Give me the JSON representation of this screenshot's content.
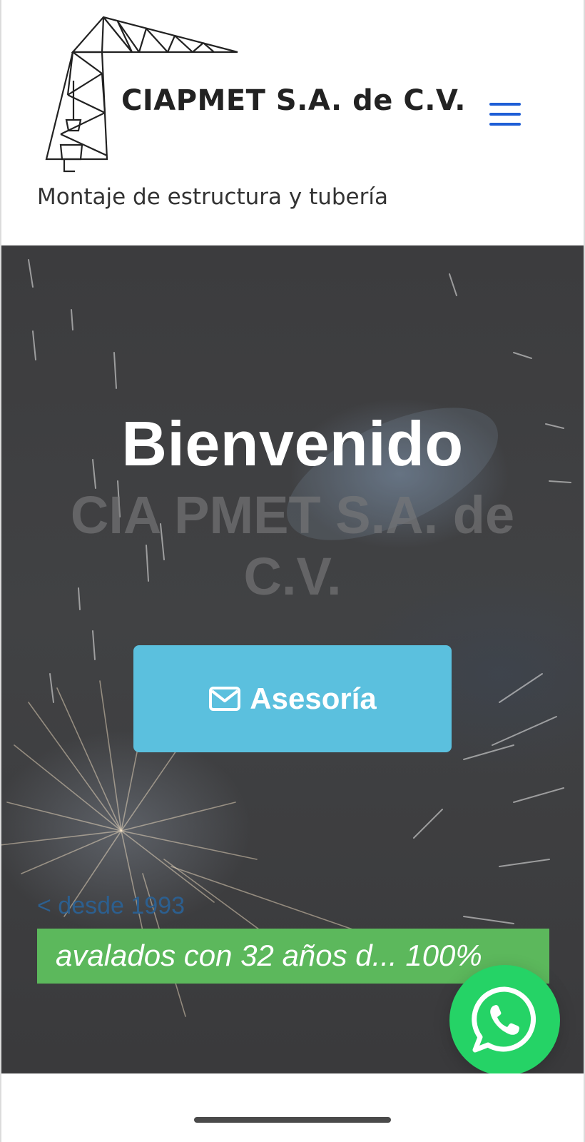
{
  "header": {
    "logo_text": "CIAPMET S.A. de C.V.",
    "tagline": "Montaje de estructura y tubería",
    "menu_icon": "hamburger-menu-icon",
    "menu_color": "#1e5ed6"
  },
  "hero": {
    "title": "Bienvenido",
    "subtitle": "CIA PMET S.A. de C.V.",
    "cta": {
      "label": "Asesoría",
      "icon": "envelope-icon",
      "color": "#5bc0de"
    },
    "since_link": "< desde 1993",
    "progress": {
      "text": "avalados con 32 años d... 100%",
      "percent": 100,
      "color": "#5cb85c"
    }
  },
  "whatsapp": {
    "icon": "whatsapp-icon",
    "color": "#25d366"
  }
}
